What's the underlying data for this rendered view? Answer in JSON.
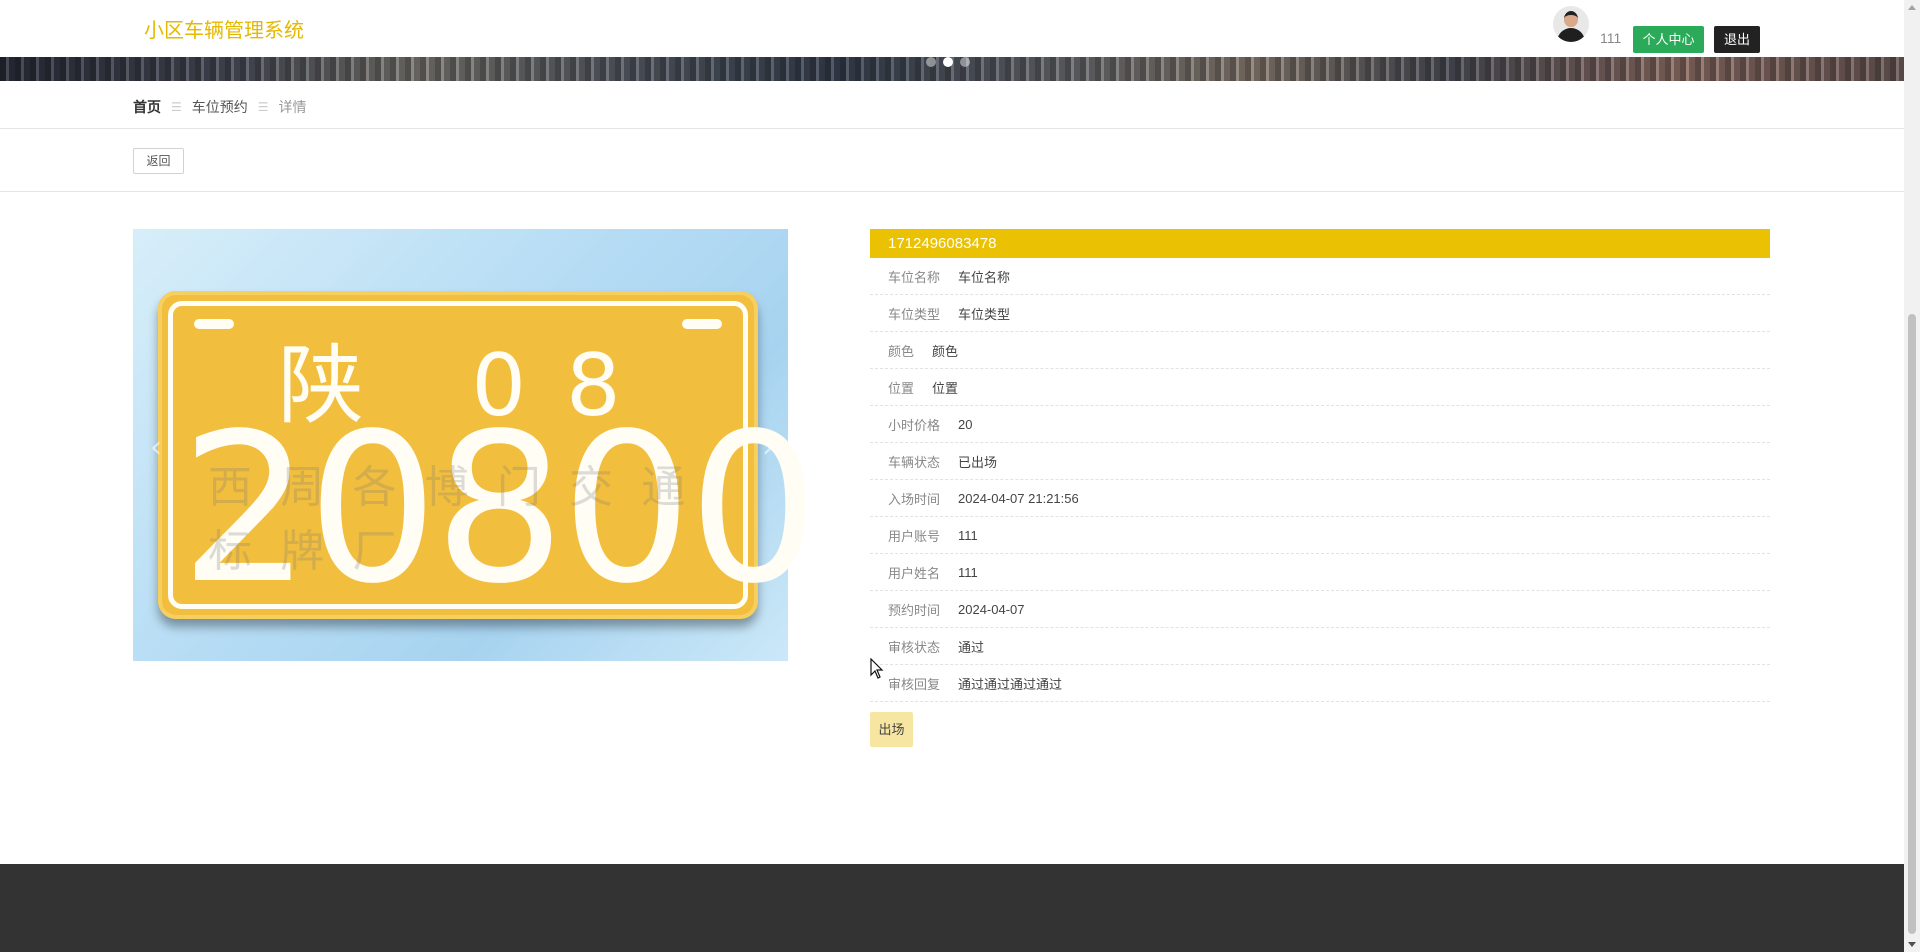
{
  "header": {
    "site_title": "小区车辆管理系统",
    "username": "111",
    "profile_button": "个人中心",
    "logout_button": "退出"
  },
  "breadcrumb": {
    "home": "首页",
    "section": "车位预约",
    "current": "详情",
    "separator": "☰"
  },
  "back_button": "返回",
  "image": {
    "plate_line1": "陕 08",
    "plate_line2": "20800",
    "watermark": "西 周 各 博 门 交 通 标 牌 厂",
    "prev_arrow": "‹",
    "next_arrow": "›"
  },
  "detail": {
    "title": "1712496083478",
    "fields": [
      {
        "label": "车位名称",
        "value": "车位名称"
      },
      {
        "label": "车位类型",
        "value": "车位类型"
      },
      {
        "label": "颜色",
        "value": "颜色"
      },
      {
        "label": "位置",
        "value": "位置"
      },
      {
        "label": "小时价格",
        "value": "20"
      },
      {
        "label": "车辆状态",
        "value": "已出场"
      },
      {
        "label": "入场时间",
        "value": "2024-04-07 21:21:56"
      },
      {
        "label": "用户账号",
        "value": "111"
      },
      {
        "label": "用户姓名",
        "value": "111"
      },
      {
        "label": "预约时间",
        "value": "2024-04-07"
      },
      {
        "label": "审核状态",
        "value": "通过"
      },
      {
        "label": "审核回复",
        "value": "通过通过通过通过"
      }
    ],
    "exit_button": "出场"
  },
  "colors": {
    "accent_yellow": "#ebc104",
    "title_yellow": "#e6b800",
    "green_button": "#2bab5a",
    "footer": "#333333"
  }
}
